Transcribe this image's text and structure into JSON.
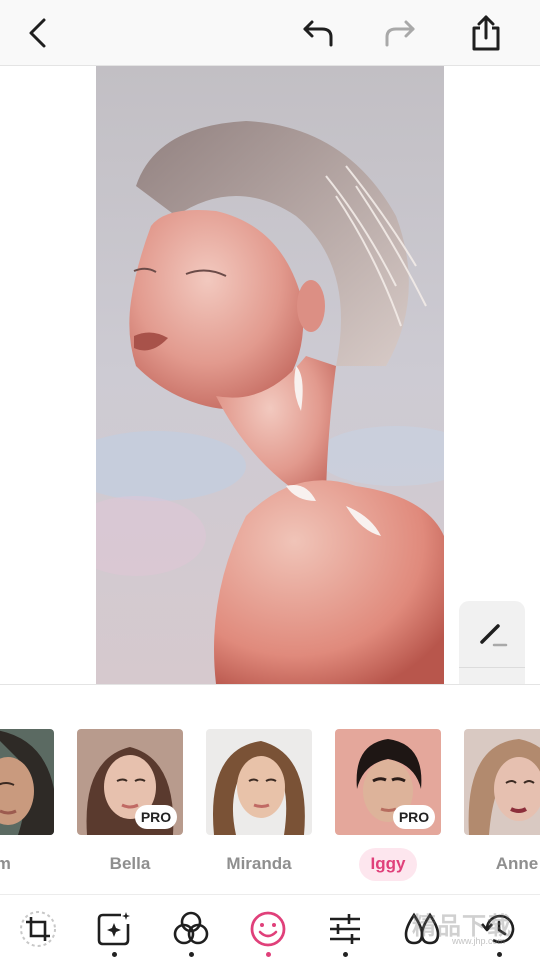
{
  "colors": {
    "accent": "#e0407a",
    "accent_light": "#fde6ee",
    "icon": "#1f1f1f",
    "icon_disabled": "#a9a9a9"
  },
  "topbar": {
    "back_icon": "chevron-left-icon",
    "undo_icon": "undo-icon",
    "redo_icon": "redo-icon",
    "redo_enabled": false,
    "share_icon": "share-icon"
  },
  "canvas": {
    "side_tools": [
      {
        "name": "brush-eraser-icon"
      },
      {
        "name": "compare-icon"
      }
    ]
  },
  "models": [
    {
      "label": "im",
      "pro": false,
      "selected": false
    },
    {
      "label": "Bella",
      "pro": true,
      "pro_label": "PRO",
      "selected": false
    },
    {
      "label": "Miranda",
      "pro": false,
      "selected": false
    },
    {
      "label": "Iggy",
      "pro": true,
      "pro_label": "PRO",
      "selected": true
    },
    {
      "label": "Anne",
      "pro": false,
      "selected": false
    }
  ],
  "bottombar": {
    "tools": [
      {
        "icon": "crop-icon",
        "dot": false
      },
      {
        "icon": "magic-enhance-icon",
        "dot": true
      },
      {
        "icon": "filters-icon",
        "dot": true
      },
      {
        "icon": "face-retouch-icon",
        "dot": true,
        "active": true
      },
      {
        "icon": "adjust-sliders-icon",
        "dot": true
      },
      {
        "icon": "drops-icon",
        "dot": false
      },
      {
        "icon": "history-icon",
        "dot": true
      }
    ]
  },
  "watermark": {
    "text": "精品下载",
    "sub": "www.jhp.com"
  }
}
